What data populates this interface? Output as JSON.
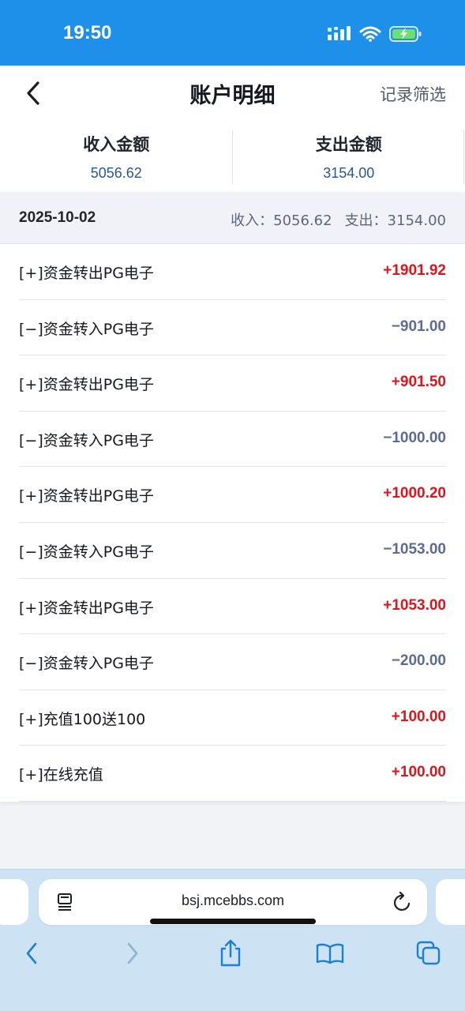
{
  "status_bar": {
    "time": "19:50"
  },
  "header": {
    "title": "账户明细",
    "filter_label": "记录筛选"
  },
  "summary": {
    "income_label": "收入金额",
    "income_value": "5056.62",
    "expense_label": "支出金额",
    "expense_value": "3154.00"
  },
  "day": {
    "date": "2025-10-02",
    "income_text": "收入：5056.62",
    "expense_text": "支出：3154.00"
  },
  "transactions": [
    {
      "title": "[+]资金转出PG电子",
      "amount": "+1901.92",
      "type": "pos"
    },
    {
      "title": "[−]资金转入PG电子",
      "amount": "−901.00",
      "type": "neg"
    },
    {
      "title": "[+]资金转出PG电子",
      "amount": "+901.50",
      "type": "pos"
    },
    {
      "title": "[−]资金转入PG电子",
      "amount": "−1000.00",
      "type": "neg"
    },
    {
      "title": "[+]资金转出PG电子",
      "amount": "+1000.20",
      "type": "pos"
    },
    {
      "title": "[−]资金转入PG电子",
      "amount": "−1053.00",
      "type": "neg"
    },
    {
      "title": "[+]资金转出PG电子",
      "amount": "+1053.00",
      "type": "pos"
    },
    {
      "title": "[−]资金转入PG电子",
      "amount": "−200.00",
      "type": "neg"
    },
    {
      "title": "[+]充值100送100",
      "amount": "+100.00",
      "type": "pos"
    },
    {
      "title": "[+]在线充值",
      "amount": "+100.00",
      "type": "pos"
    }
  ],
  "browser": {
    "url": "bsj.mcebbs.com"
  },
  "colors": {
    "accent": "#1e90ea",
    "positive": "#e0141b",
    "negative": "#5d6a96",
    "link_blue": "#2a5790"
  }
}
